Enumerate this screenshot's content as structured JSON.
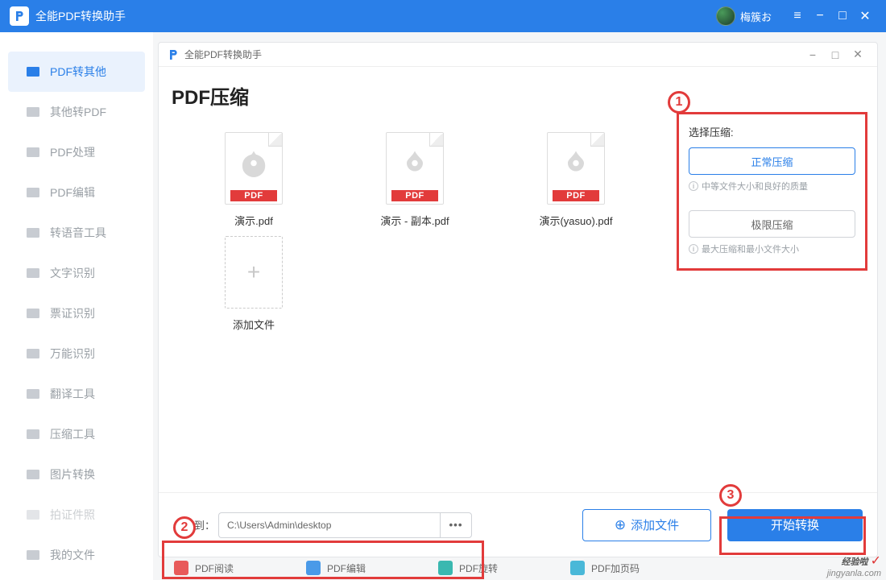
{
  "titlebar": {
    "title": "全能PDF转换助手",
    "user": "梅簇お"
  },
  "sidebar": {
    "items": [
      {
        "label": "PDF转其他"
      },
      {
        "label": "其他转PDF"
      },
      {
        "label": "PDF处理"
      },
      {
        "label": "PDF编辑"
      },
      {
        "label": "转语音工具"
      },
      {
        "label": "文字识别"
      },
      {
        "label": "票证识别"
      },
      {
        "label": "万能识别"
      },
      {
        "label": "翻译工具"
      },
      {
        "label": "压缩工具"
      },
      {
        "label": "图片转换"
      },
      {
        "label": "拍证件照"
      },
      {
        "label": "我的文件"
      }
    ]
  },
  "panel": {
    "header_title": "全能PDF转换助手",
    "page_title": "PDF压缩",
    "files": [
      {
        "name": "演示.pdf",
        "tag": "PDF"
      },
      {
        "name": "演示 - 副本.pdf",
        "tag": "PDF"
      },
      {
        "name": "演示(yasuo).pdf",
        "tag": "PDF"
      }
    ],
    "add_label": "添加文件"
  },
  "options": {
    "section_label": "选择压缩:",
    "normal_btn": "正常压缩",
    "normal_hint": "中等文件大小和良好的质量",
    "extreme_btn": "极限压缩",
    "extreme_hint": "最大压缩和最小文件大小"
  },
  "footer": {
    "save_label": "保存到：",
    "save_path": "C:\\Users\\Admin\\desktop",
    "add_btn": "添加文件",
    "start_btn": "开始转换"
  },
  "callouts": {
    "c1": "1",
    "c2": "2",
    "c3": "3"
  },
  "bottom_tabs": [
    {
      "label": "PDF阅读"
    },
    {
      "label": "PDF编辑"
    },
    {
      "label": "PDF旋转"
    },
    {
      "label": "PDF加页码"
    }
  ],
  "watermark": {
    "text": "经验啦",
    "url": "jingyanla.com"
  }
}
